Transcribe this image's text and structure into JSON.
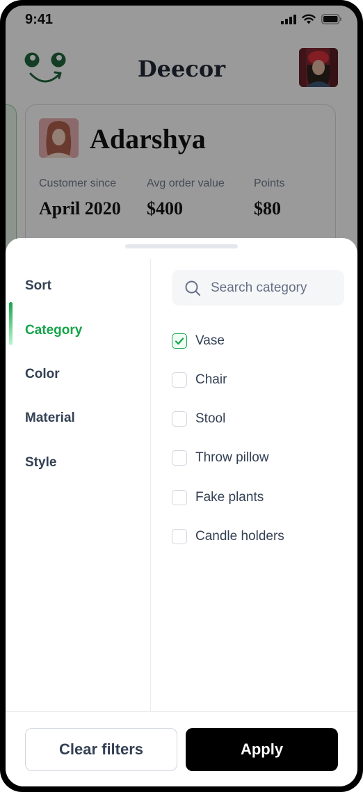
{
  "status_bar": {
    "time": "9:41"
  },
  "header": {
    "app_name": "Deecor"
  },
  "customer": {
    "name": "Adarshya",
    "stats": [
      {
        "label": "Customer since",
        "value": "April 2020"
      },
      {
        "label": "Avg order value",
        "value": "$400"
      },
      {
        "label": "Points",
        "value": "$80"
      }
    ]
  },
  "filter_sheet": {
    "nav": [
      {
        "label": "Sort",
        "active": false
      },
      {
        "label": "Category",
        "active": true
      },
      {
        "label": "Color",
        "active": false
      },
      {
        "label": "Material",
        "active": false
      },
      {
        "label": "Style",
        "active": false
      }
    ],
    "search": {
      "placeholder": "Search category",
      "value": ""
    },
    "options": [
      {
        "label": "Vase",
        "checked": true
      },
      {
        "label": "Chair",
        "checked": false
      },
      {
        "label": "Stool",
        "checked": false
      },
      {
        "label": "Throw pillow",
        "checked": false
      },
      {
        "label": "Fake plants",
        "checked": false
      },
      {
        "label": "Candle holders",
        "checked": false
      }
    ],
    "buttons": {
      "clear_label": "Clear filters",
      "apply_label": "Apply"
    }
  },
  "colors": {
    "accent_green": "#16a34a",
    "primary_button": "#000000",
    "overlay": "rgba(25,25,25,0.44)"
  },
  "icons": [
    "smile-logo-icon",
    "signal-icon",
    "wifi-icon",
    "battery-icon",
    "search-icon",
    "checkmark-icon"
  ]
}
